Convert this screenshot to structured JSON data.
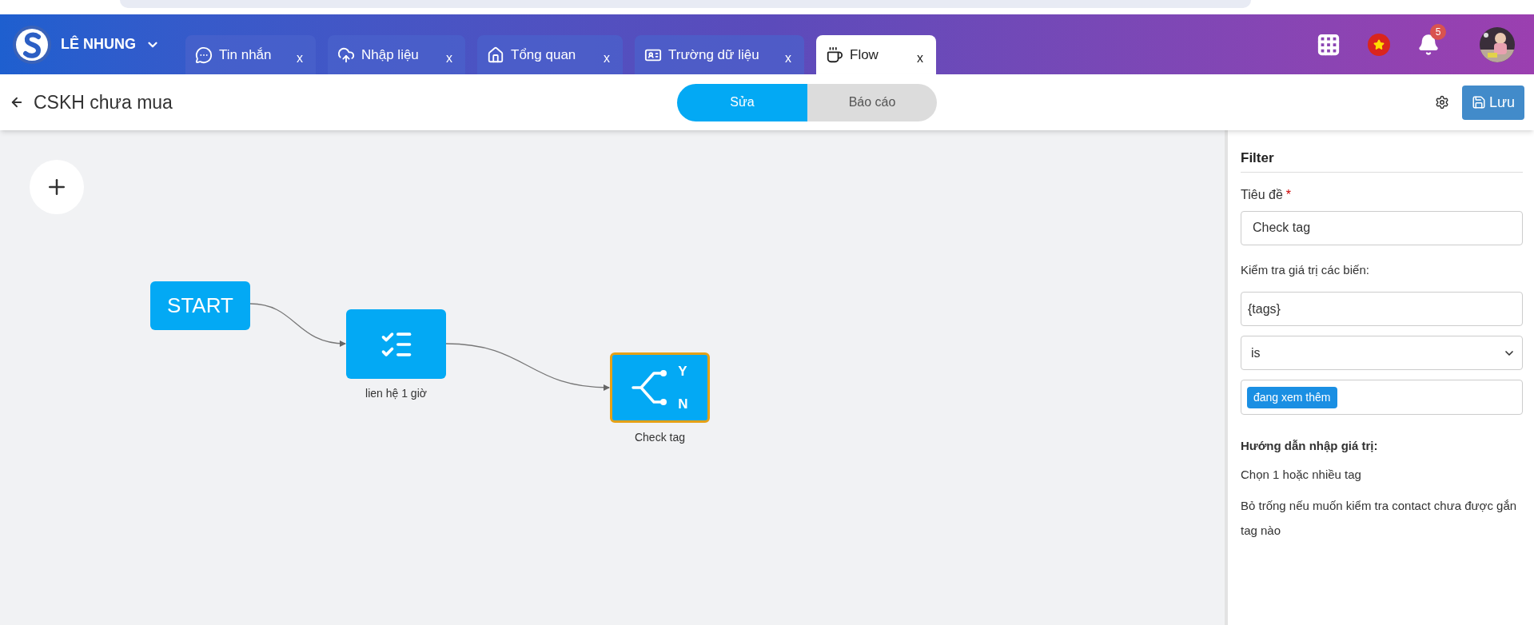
{
  "header": {
    "user": "LÊ NHUNG",
    "notifications": "5"
  },
  "tabs": [
    {
      "kind": "chat",
      "label": "Tin nhắn",
      "close": "x",
      "selected": false
    },
    {
      "kind": "upload",
      "label": "Nhập liệu",
      "close": "x",
      "selected": false
    },
    {
      "kind": "home",
      "label": "Tổng quan",
      "close": "x",
      "selected": false
    },
    {
      "kind": "card",
      "label": "Trường dữ liệu",
      "close": "x",
      "selected": false
    },
    {
      "kind": "cup",
      "label": "Flow",
      "close": "x",
      "selected": true
    }
  ],
  "toolbar": {
    "title": "CSKH chưa mua",
    "modes": [
      {
        "label": "Sửa",
        "selected": true
      },
      {
        "label": "Báo cáo",
        "selected": false
      }
    ],
    "save": "Lưu"
  },
  "canvas": {
    "nodes": [
      {
        "kind": "start",
        "label": "START",
        "selected": false
      },
      {
        "kind": "task",
        "caption": "lien hệ 1 giờ",
        "selected": false
      },
      {
        "kind": "filter",
        "caption": "Check tag",
        "yes": "Y",
        "no": "N",
        "selected": true
      }
    ]
  },
  "panel": {
    "title": "Filter",
    "title_label": "Tiêu đề",
    "required": "*",
    "title_value": "Check tag",
    "variables_label": "Kiểm tra giá trị các biến:",
    "variable_value": "{tags}",
    "operator": "is",
    "tags": [
      "đang xem thêm"
    ],
    "help_title": "Hướng dẫn nhập giá trị:",
    "help_lines": [
      "Chọn 1 hoặc nhiều tag",
      "Bỏ trống nếu muốn kiểm tra contact chưa được gắn tag nào"
    ]
  }
}
